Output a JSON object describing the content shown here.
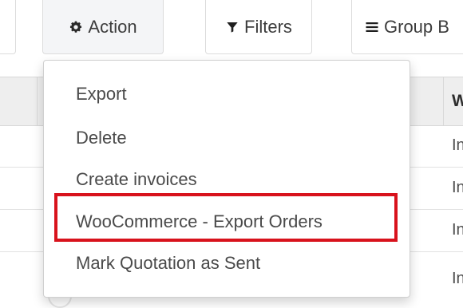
{
  "toolbar": {
    "action_label": "Action",
    "filters_label": "Filters",
    "group_label": "Group B"
  },
  "table": {
    "header_partial": "W",
    "row_partials": [
      "In",
      "In",
      "In",
      "In"
    ]
  },
  "action_menu": {
    "items": [
      {
        "label": "Export"
      },
      {
        "label": "Delete"
      },
      {
        "label": "Create invoices"
      },
      {
        "label": "WooCommerce - Export Orders"
      },
      {
        "label": "Mark Quotation as Sent"
      }
    ],
    "highlighted_index": 3,
    "highlight_color": "#d8121c"
  },
  "icons": {
    "action": "gear-icon",
    "filters": "funnel-icon",
    "group": "bars-icon"
  }
}
